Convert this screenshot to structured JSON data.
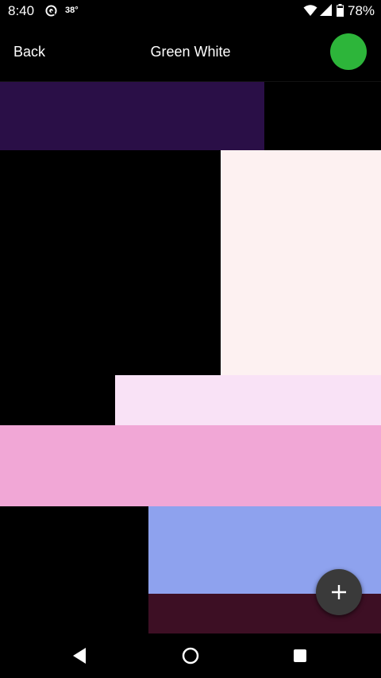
{
  "status_bar": {
    "time": "8:40",
    "temperature": "38°",
    "battery": "78%",
    "icons": [
      "sync-icon",
      "wifi-icon",
      "signal-icon",
      "battery-icon"
    ]
  },
  "app_bar": {
    "back_label": "Back",
    "title": "Green White",
    "accent_color": "#2db53a"
  },
  "swatches": [
    {
      "color": "#2a0f47"
    },
    {
      "color": "#fdf1f1"
    },
    {
      "color": "#f9e2f6"
    },
    {
      "color": "#f1a7d6"
    },
    {
      "color": "#8ea2ee"
    },
    {
      "color": "#3d0f24"
    }
  ],
  "fab": {
    "icon": "plus-icon",
    "color": "#3a3a3a"
  },
  "nav_bar": {
    "icons": [
      "back-triangle-icon",
      "home-circle-icon",
      "recents-square-icon"
    ]
  }
}
